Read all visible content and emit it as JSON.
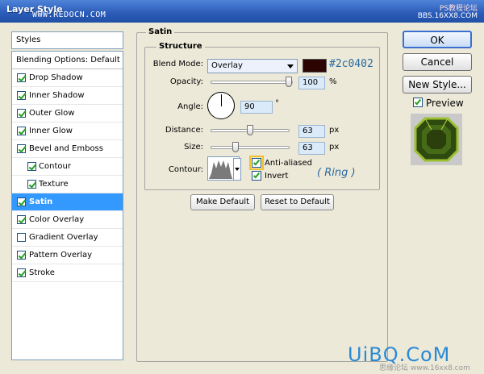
{
  "window": {
    "title": "Layer Style",
    "watermark_url": "WWW.REDOCN.COM",
    "watermark_right_1": "PS教程论坛",
    "watermark_right_2": "BBS.16XX8.COM"
  },
  "styles_header": "Styles",
  "list": [
    {
      "label": "Blending Options: Default",
      "checkbox": false,
      "checked": false,
      "sub": false,
      "active": false
    },
    {
      "label": "Drop Shadow",
      "checkbox": true,
      "checked": true,
      "sub": false,
      "active": false
    },
    {
      "label": "Inner Shadow",
      "checkbox": true,
      "checked": true,
      "sub": false,
      "active": false
    },
    {
      "label": "Outer Glow",
      "checkbox": true,
      "checked": true,
      "sub": false,
      "active": false
    },
    {
      "label": "Inner Glow",
      "checkbox": true,
      "checked": true,
      "sub": false,
      "active": false
    },
    {
      "label": "Bevel and Emboss",
      "checkbox": true,
      "checked": true,
      "sub": false,
      "active": false
    },
    {
      "label": "Contour",
      "checkbox": true,
      "checked": true,
      "sub": true,
      "active": false
    },
    {
      "label": "Texture",
      "checkbox": true,
      "checked": true,
      "sub": true,
      "active": false
    },
    {
      "label": "Satin",
      "checkbox": true,
      "checked": true,
      "sub": false,
      "active": true
    },
    {
      "label": "Color Overlay",
      "checkbox": true,
      "checked": true,
      "sub": false,
      "active": false
    },
    {
      "label": "Gradient Overlay",
      "checkbox": true,
      "checked": false,
      "sub": false,
      "active": false
    },
    {
      "label": "Pattern Overlay",
      "checkbox": true,
      "checked": true,
      "sub": false,
      "active": false
    },
    {
      "label": "Stroke",
      "checkbox": true,
      "checked": true,
      "sub": false,
      "active": false
    }
  ],
  "satin": {
    "title": "Satin",
    "structure_title": "Structure",
    "blend_mode_label": "Blend Mode:",
    "blend_mode_value": "Overlay",
    "color_hex": "#2c0402",
    "color_annotation": "#2c0402",
    "opacity_label": "Opacity:",
    "opacity_value": "100",
    "opacity_fraction": 1.0,
    "opacity_unit": "%",
    "angle_label": "Angle:",
    "angle_value": "90",
    "angle_unit": "°",
    "distance_label": "Distance:",
    "distance_value": "63",
    "distance_fraction": 0.5,
    "distance_unit": "px",
    "size_label": "Size:",
    "size_value": "63",
    "size_fraction": 0.3,
    "size_unit": "px",
    "contour_label": "Contour:",
    "anti_aliased_label": "Anti-aliased",
    "anti_aliased_checked": true,
    "invert_label": "Invert",
    "invert_checked": true,
    "ring_annotation": "( Ring )",
    "make_default_label": "Make Default",
    "reset_default_label": "Reset to Default"
  },
  "right_panel": {
    "ok_label": "OK",
    "cancel_label": "Cancel",
    "new_style_label": "New Style...",
    "preview_label": "Preview",
    "preview_checked": true
  },
  "footer_watermark": "UiBQ.CoM",
  "footer_watermark_small": "思缘论坛 www.16xx8.com"
}
